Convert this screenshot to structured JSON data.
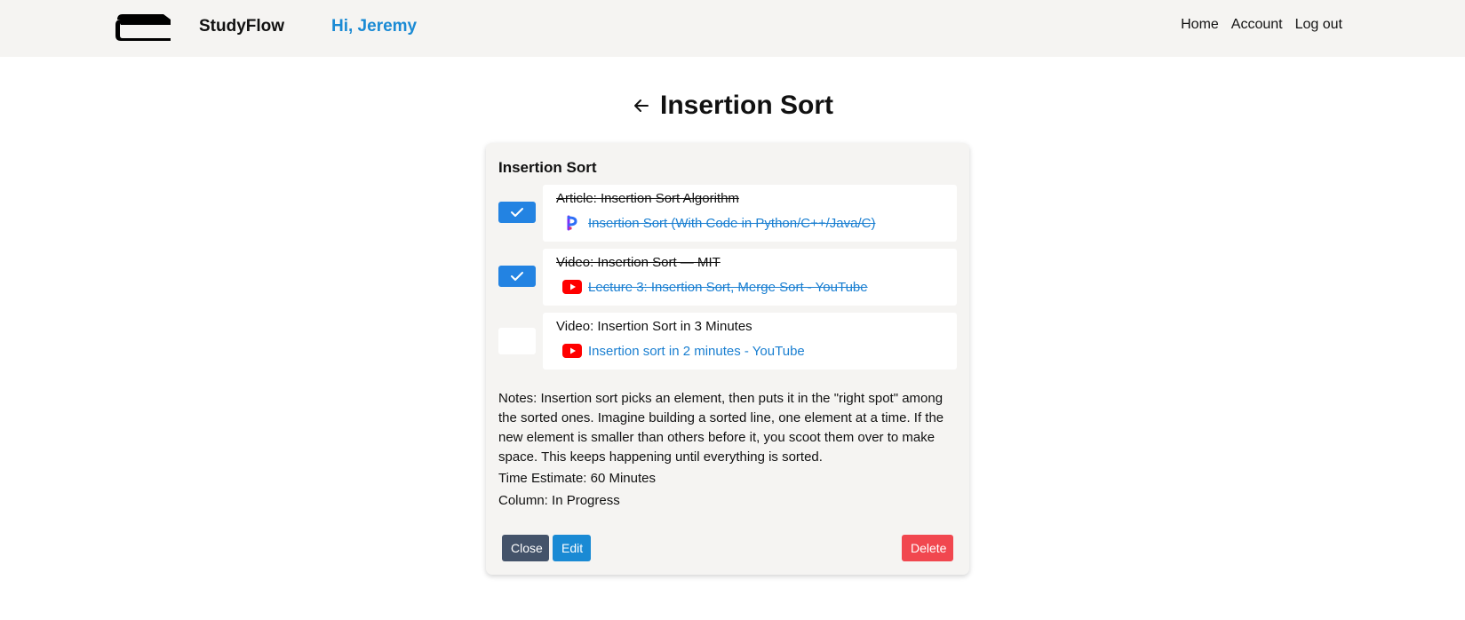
{
  "header": {
    "brand": "StudyFlow",
    "greeting": "Hi, Jeremy",
    "nav": [
      "Home",
      "Account",
      "Log out"
    ]
  },
  "page": {
    "title": "Insertion Sort"
  },
  "card": {
    "title": "Insertion Sort",
    "tasks": [
      {
        "name": "Article: Insertion Sort Algorithm",
        "link_text": "Insertion Sort (With Code in Python/C++/Java/C)",
        "link_icon": "programiz-icon",
        "completed": true
      },
      {
        "name": "Video: Insertion Sort — MIT",
        "link_text": "Lecture 3: Insertion Sort, Merge Sort - YouTube",
        "link_icon": "youtube-icon",
        "completed": true
      },
      {
        "name": "Video: Insertion Sort in 3 Minutes",
        "link_text": "Insertion sort in 2 minutes - YouTube",
        "link_icon": "youtube-icon",
        "completed": false
      }
    ],
    "notes": "Notes: Insertion sort picks an element, then puts it in the \"right spot\" among the sorted ones. Imagine building a sorted line, one element at a time. If the new element is smaller than others before it, you scoot them over to make space. This keeps happening until everything is sorted.",
    "time_estimate": "Time Estimate: 60 Minutes",
    "column": "Column: In Progress",
    "buttons": {
      "close": "Close",
      "edit": "Edit",
      "delete": "Delete"
    }
  },
  "colors": {
    "accent": "#1a8ad4",
    "checkbox_checked": "#2383e2",
    "close_button": "#44536a",
    "delete_button": "#f1474f",
    "link": "#1a7fd1",
    "header_bg": "#f5f4f2"
  }
}
